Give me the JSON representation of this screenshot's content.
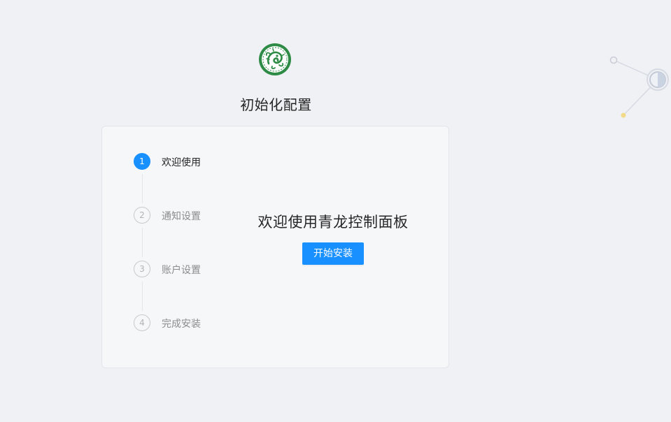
{
  "page": {
    "title": "初始化配置",
    "logo_icon": "qinglong-dragon-logo-icon",
    "decoration_icon": "node-network-decoration-icon"
  },
  "steps": [
    {
      "number": "1",
      "label": "欢迎使用",
      "state": "active"
    },
    {
      "number": "2",
      "label": "通知设置",
      "state": "pending"
    },
    {
      "number": "3",
      "label": "账户设置",
      "state": "pending"
    },
    {
      "number": "4",
      "label": "完成安装",
      "state": "pending"
    }
  ],
  "main": {
    "heading": "欢迎使用青龙控制面板",
    "start_button_label": "开始安装"
  },
  "colors": {
    "accent": "#1890ff",
    "background": "#f0f1f5",
    "card": "#f6f7f9",
    "logo_green": "#2e8b45",
    "deco_yellow": "#f3d98a"
  }
}
